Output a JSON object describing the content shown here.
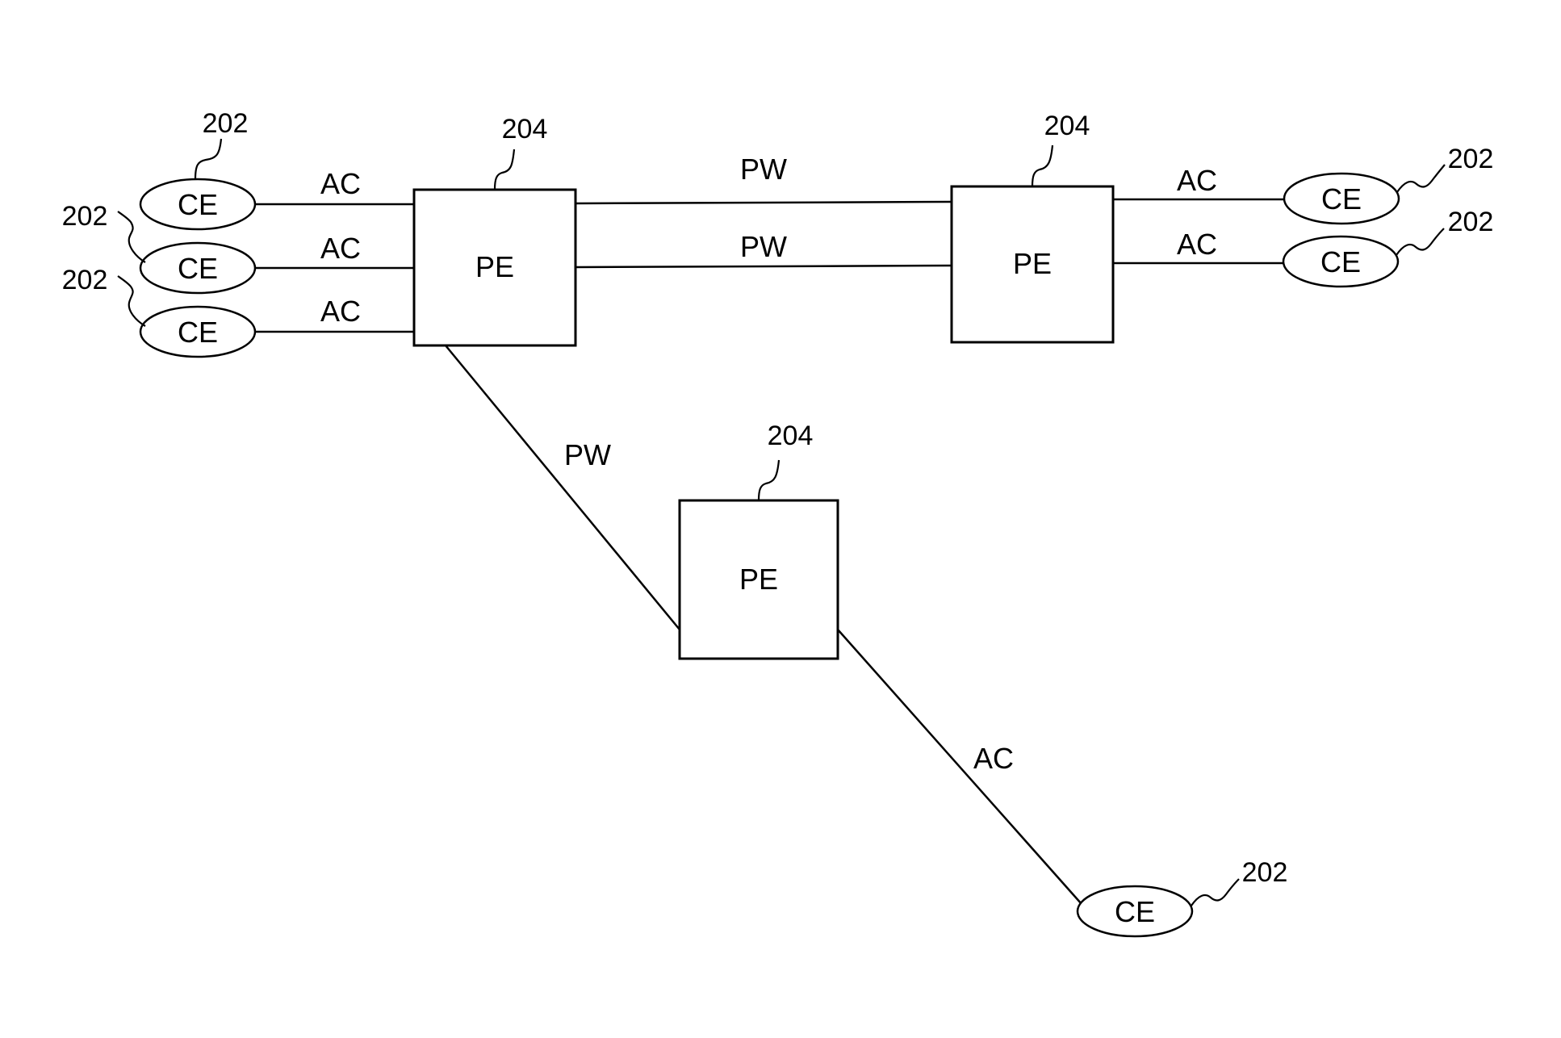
{
  "diagram": {
    "pe_nodes": [
      {
        "id": "pe-1",
        "label": "PE",
        "ref": "204"
      },
      {
        "id": "pe-2",
        "label": "PE",
        "ref": "204"
      },
      {
        "id": "pe-3",
        "label": "PE",
        "ref": "204"
      }
    ],
    "ce_nodes": [
      {
        "id": "ce-1",
        "label": "CE",
        "ref": "202"
      },
      {
        "id": "ce-2",
        "label": "CE",
        "ref": "202"
      },
      {
        "id": "ce-3",
        "label": "CE",
        "ref": "202"
      },
      {
        "id": "ce-4",
        "label": "CE",
        "ref": "202"
      },
      {
        "id": "ce-5",
        "label": "CE",
        "ref": "202"
      },
      {
        "id": "ce-6",
        "label": "CE",
        "ref": "202"
      }
    ],
    "links": [
      {
        "from": "ce-1",
        "to": "pe-1",
        "label": "AC"
      },
      {
        "from": "ce-2",
        "to": "pe-1",
        "label": "AC"
      },
      {
        "from": "ce-3",
        "to": "pe-1",
        "label": "AC"
      },
      {
        "from": "pe-1",
        "to": "pe-2",
        "label": "PW"
      },
      {
        "from": "pe-1",
        "to": "pe-2",
        "label": "PW"
      },
      {
        "from": "pe-2",
        "to": "ce-4",
        "label": "AC"
      },
      {
        "from": "pe-2",
        "to": "ce-5",
        "label": "AC"
      },
      {
        "from": "pe-1",
        "to": "pe-3",
        "label": "PW"
      },
      {
        "from": "pe-3",
        "to": "ce-6",
        "label": "AC"
      }
    ]
  }
}
